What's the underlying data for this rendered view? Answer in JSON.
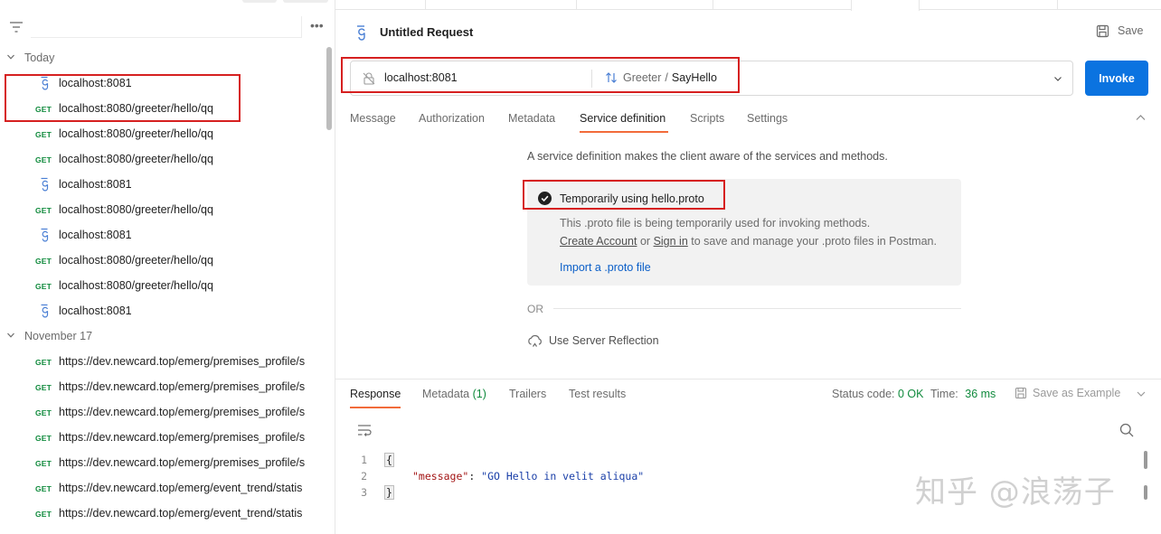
{
  "sidebar": {
    "more_icon": "more-horizontal-icon",
    "groups": [
      {
        "label": "Today",
        "items": [
          {
            "type": "grpc",
            "label": "localhost:8081"
          },
          {
            "type": "http",
            "method": "GET",
            "label": "localhost:8080/greeter/hello/qq"
          },
          {
            "type": "http",
            "method": "GET",
            "label": "localhost:8080/greeter/hello/qq"
          },
          {
            "type": "http",
            "method": "GET",
            "label": "localhost:8080/greeter/hello/qq"
          },
          {
            "type": "grpc",
            "label": "localhost:8081"
          },
          {
            "type": "http",
            "method": "GET",
            "label": "localhost:8080/greeter/hello/qq"
          },
          {
            "type": "grpc",
            "label": "localhost:8081"
          },
          {
            "type": "http",
            "method": "GET",
            "label": "localhost:8080/greeter/hello/qq"
          },
          {
            "type": "http",
            "method": "GET",
            "label": "localhost:8080/greeter/hello/qq"
          },
          {
            "type": "grpc",
            "label": "localhost:8081"
          }
        ]
      },
      {
        "label": "November 17",
        "items": [
          {
            "type": "http",
            "method": "GET",
            "label": "https://dev.newcard.top/emerg/premises_profile/s"
          },
          {
            "type": "http",
            "method": "GET",
            "label": "https://dev.newcard.top/emerg/premises_profile/s"
          },
          {
            "type": "http",
            "method": "GET",
            "label": "https://dev.newcard.top/emerg/premises_profile/s"
          },
          {
            "type": "http",
            "method": "GET",
            "label": "https://dev.newcard.top/emerg/premises_profile/s"
          },
          {
            "type": "http",
            "method": "GET",
            "label": "https://dev.newcard.top/emerg/premises_profile/s"
          },
          {
            "type": "http",
            "method": "GET",
            "label": "https://dev.newcard.top/emerg/event_trend/statis"
          },
          {
            "type": "http",
            "method": "GET",
            "label": "https://dev.newcard.top/emerg/event_trend/statis"
          }
        ]
      }
    ]
  },
  "request": {
    "title": "Untitled Request",
    "save_label": "Save",
    "url": "localhost:8081",
    "service": "Greeter",
    "separator": "/",
    "method": "SayHello",
    "invoke_label": "Invoke",
    "tabs": [
      "Message",
      "Authorization",
      "Metadata",
      "Service definition",
      "Scripts",
      "Settings"
    ],
    "active_tab": "Service definition"
  },
  "service_definition": {
    "description": "A service definition makes the client aware of the services and methods.",
    "proto_title": "Temporarily using hello.proto",
    "proto_line1": "This .proto file is being temporarily used for invoking methods.",
    "create_account": "Create Account",
    "or_word": "or",
    "sign_in": "Sign in",
    "proto_line2_rest": "to save and manage your .proto files in Postman.",
    "import_label": "Import a .proto file",
    "or_label": "OR",
    "reflection_label": "Use Server Reflection"
  },
  "response": {
    "tabs": {
      "response": "Response",
      "metadata": "Metadata",
      "metadata_count": "(1)",
      "trailers": "Trailers",
      "tests": "Test results"
    },
    "status_label": "Status code:",
    "status_value": "0 OK",
    "time_label": "Time:",
    "time_value": "36 ms",
    "save_example_label": "Save as Example",
    "code": {
      "line_numbers": [
        "1",
        "2",
        "3"
      ],
      "open_brace": "{",
      "close_brace": "}",
      "key": "\"message\"",
      "colon": ": ",
      "value": "\"GO Hello in velit aliqua\""
    }
  },
  "watermark": "知乎 @浪荡子",
  "colors": {
    "accent_orange": "#f26b3a",
    "invoke_blue": "#0b73e0",
    "get_green": "#0f8a3c",
    "annotation_red": "#d62020"
  }
}
